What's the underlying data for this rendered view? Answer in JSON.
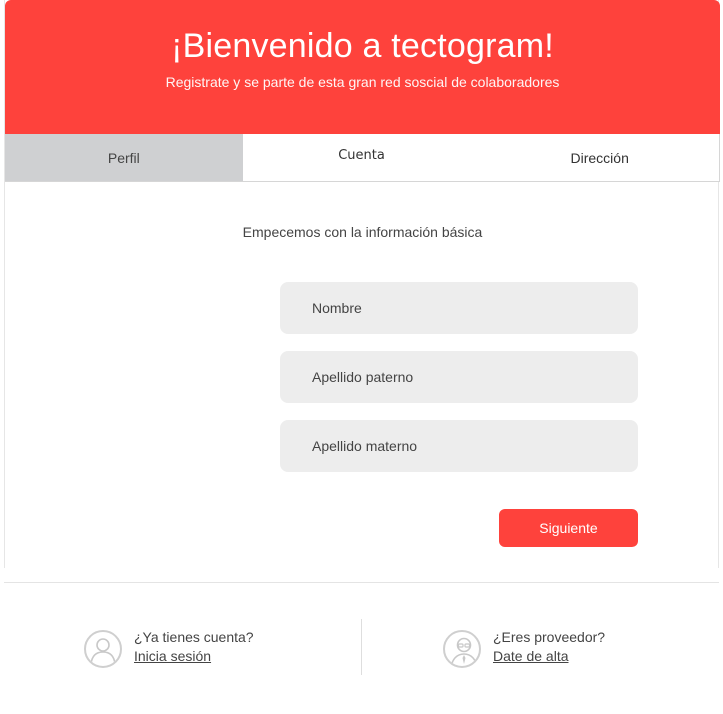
{
  "header": {
    "title": "¡Bienvenido a tectogram!",
    "subtitle": "Registrate y se parte de esta gran red soscial de colaboradores"
  },
  "tabs": [
    {
      "label": "Perfil",
      "active": true
    },
    {
      "label": "Cuenta",
      "active": false
    },
    {
      "label": "Dirección",
      "active": false
    }
  ],
  "form": {
    "intro": "Empecemos con la información básica",
    "fields": [
      {
        "placeholder": "Nombre",
        "value": ""
      },
      {
        "placeholder": "Apellido paterno",
        "value": ""
      },
      {
        "placeholder": "Apellido materno",
        "value": ""
      }
    ],
    "next_label": "Siguiente"
  },
  "footer": {
    "login": {
      "question": "¿Ya tienes cuenta?",
      "link": "Inicia sesión",
      "icon": "user-icon"
    },
    "provider": {
      "question": "¿Eres proveedor?",
      "link": "Date de alta",
      "icon": "provider-icon"
    }
  },
  "colors": {
    "accent": "#fe423c",
    "active_tab": "#cfd0d2",
    "field_bg": "#ededed"
  }
}
